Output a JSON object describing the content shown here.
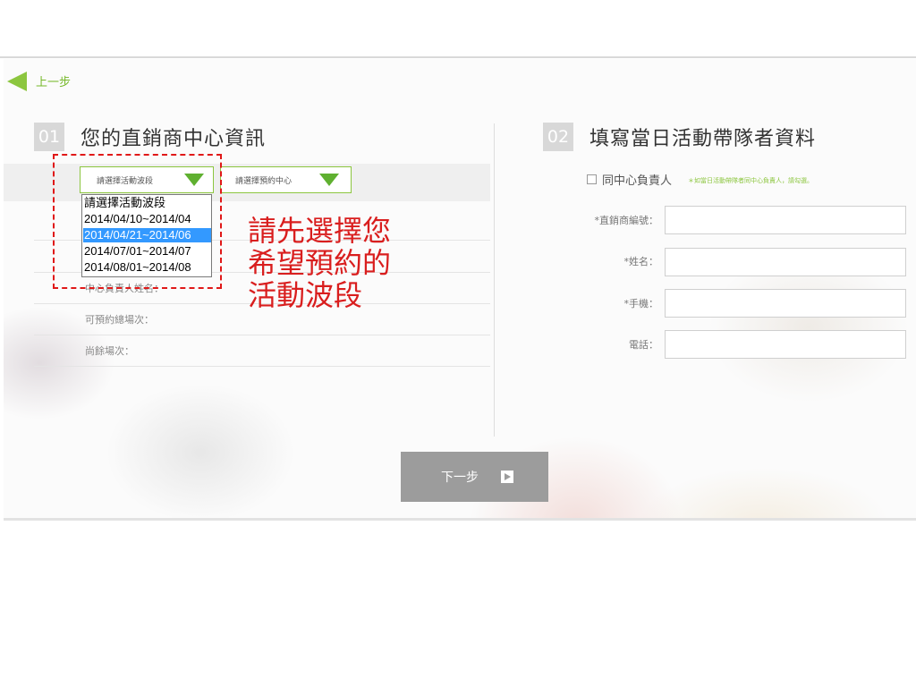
{
  "nav": {
    "back_label": "上一步"
  },
  "section1": {
    "number": "01",
    "title": "您的直銷商中心資訊",
    "wave_select_label": "請選擇活動波段",
    "center_select_label": "請選擇預約中心",
    "rows": [
      "中心負責人姓名：",
      "可預約總場次：",
      "尚餘場次："
    ]
  },
  "dropdown": {
    "options": [
      "請選擇活動波段",
      "2014/04/10~2014/04",
      "2014/04/21~2014/06",
      "2014/07/01~2014/07",
      "2014/08/01~2014/08"
    ],
    "selected": "2014/04/21~2014/06"
  },
  "annotation": {
    "line1": "請先選擇您",
    "line2": "希望預約的",
    "line3": "活動波段"
  },
  "section2": {
    "number": "02",
    "title": "填寫當日活動帶隊者資料",
    "same_person_label": "同中心負責人",
    "same_person_hint": "＊如當日活動帶隊者同中心負責人，請勾選。",
    "fields": {
      "distributor_no": "*直銷商編號：",
      "name": "*姓名：",
      "mobile": "*手機：",
      "phone": "電話："
    }
  },
  "footer": {
    "next_label": "下一步"
  },
  "colors": {
    "accent_green": "#8cc63f",
    "highlight_blue": "#3399ff",
    "annotation_red": "#d91e1e"
  }
}
